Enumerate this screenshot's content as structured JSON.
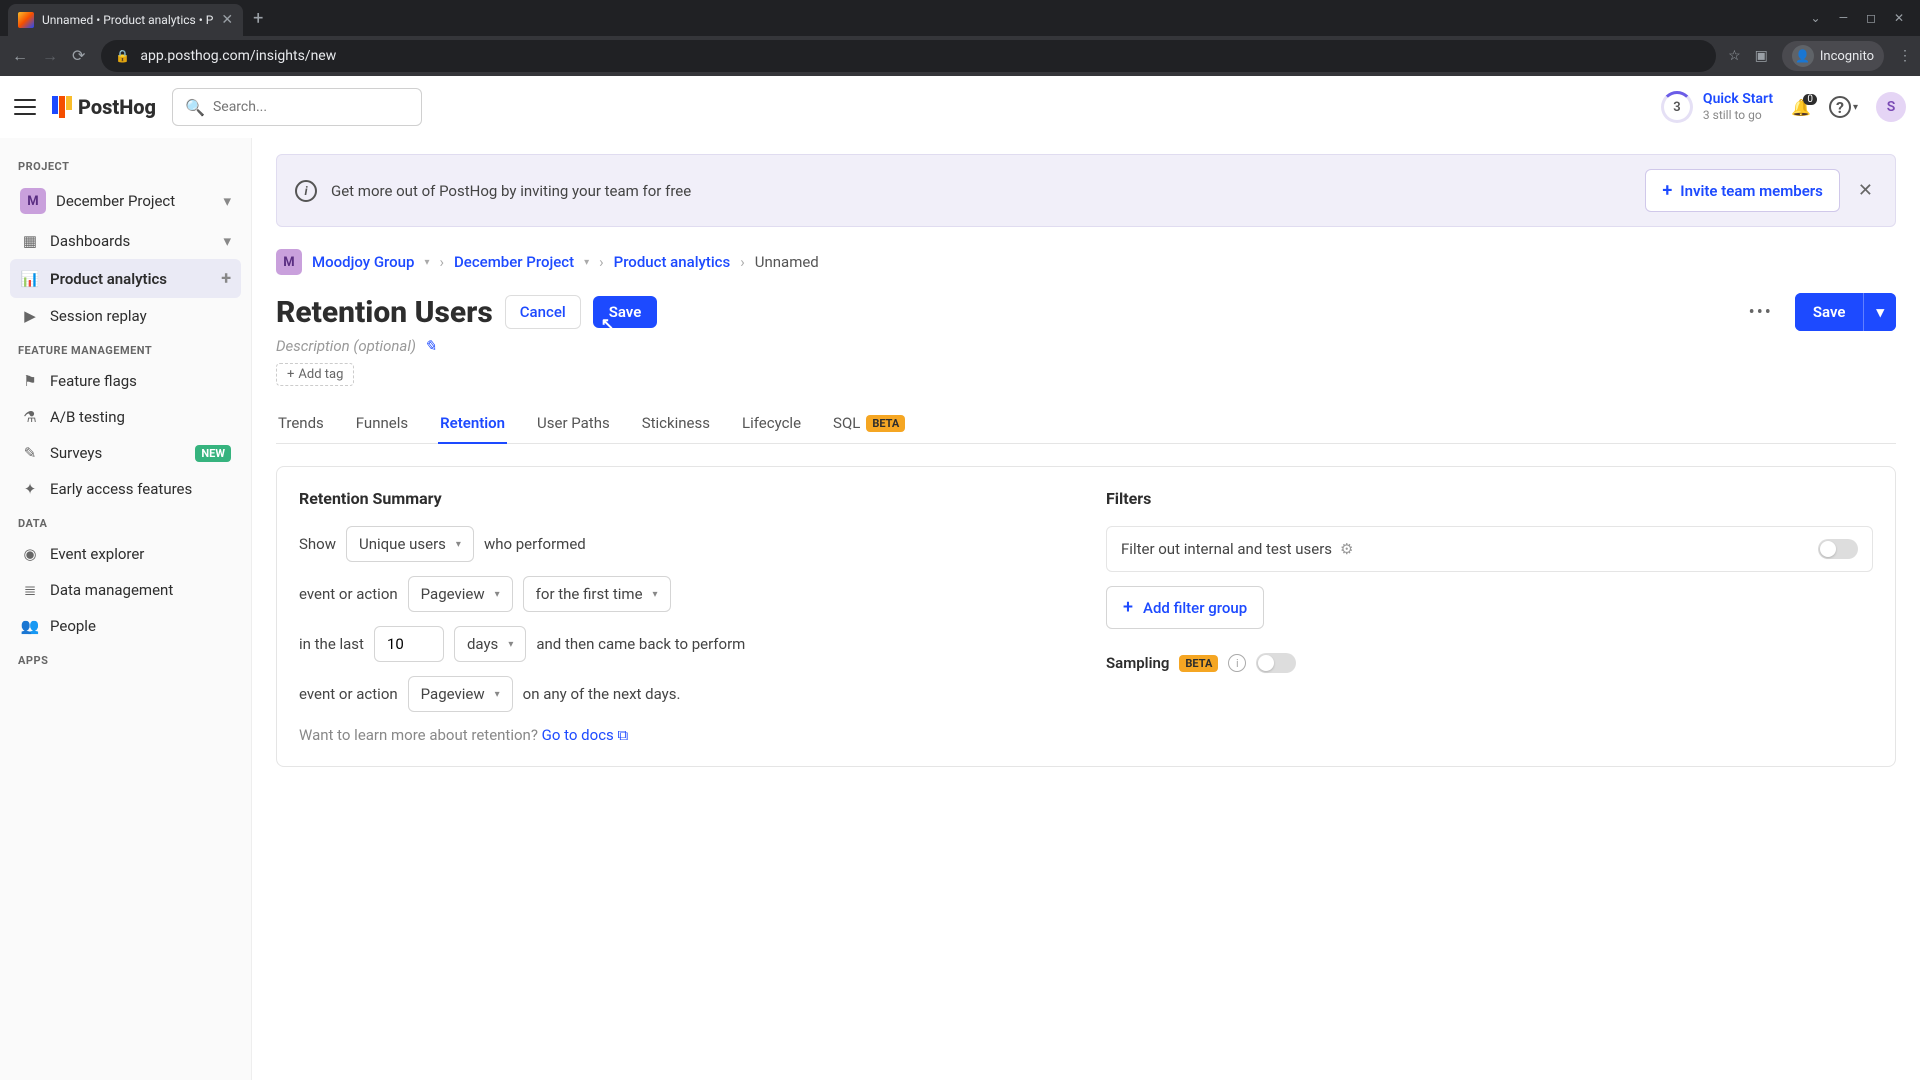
{
  "browser": {
    "tab_title": "Unnamed • Product analytics • P",
    "url": "app.posthog.com/insights/new",
    "incognito_label": "Incognito"
  },
  "topbar": {
    "logo_text": "PostHog",
    "search_placeholder": "Search...",
    "quickstart": {
      "count": "3",
      "title": "Quick Start",
      "subtitle": "3 still to go"
    },
    "notifications_badge": "0",
    "avatar_initial": "S"
  },
  "sidebar": {
    "sections": {
      "project": {
        "label": "PROJECT",
        "badge": "M",
        "name": "December Project"
      },
      "main": [
        {
          "icon": "▦",
          "label": "Dashboards",
          "trailing": "caret"
        },
        {
          "icon": "⫿",
          "label": "Product analytics",
          "trailing": "plus",
          "active": true
        },
        {
          "icon": "▶",
          "label": "Session replay"
        }
      ],
      "feature": {
        "label": "FEATURE MANAGEMENT",
        "items": [
          {
            "icon": "⚑",
            "label": "Feature flags"
          },
          {
            "icon": "⬓",
            "label": "A/B testing"
          },
          {
            "icon": "✎",
            "label": "Surveys",
            "badge": "NEW"
          },
          {
            "icon": "✦",
            "label": "Early access features"
          }
        ]
      },
      "data": {
        "label": "DATA",
        "items": [
          {
            "icon": "⟲",
            "label": "Event explorer"
          },
          {
            "icon": "≡",
            "label": "Data management"
          },
          {
            "icon": "👥",
            "label": "People"
          }
        ]
      },
      "apps": {
        "label": "APPS"
      }
    }
  },
  "banner": {
    "text": "Get more out of PostHog by inviting your team for free",
    "invite_label": "Invite team members"
  },
  "breadcrumbs": {
    "org_badge": "M",
    "org": "Moodjoy Group",
    "project": "December Project",
    "section": "Product analytics",
    "current": "Unnamed"
  },
  "title": {
    "text": "Retention Users",
    "cancel": "Cancel",
    "save_inline": "Save",
    "save_main": "Save",
    "description_placeholder": "Description (optional)",
    "add_tag": "Add tag"
  },
  "tabs": [
    "Trends",
    "Funnels",
    "Retention",
    "User Paths",
    "Stickiness",
    "Lifecycle"
  ],
  "tabs_sql": {
    "label": "SQL",
    "badge": "BETA"
  },
  "tabs_active": "Retention",
  "retention": {
    "heading": "Retention Summary",
    "show_label": "Show",
    "show_value": "Unique users",
    "who_performed": "who performed",
    "event_label1": "event or action",
    "event_value1": "Pageview",
    "first_time": "for the first time",
    "in_last": "in the last",
    "period_value": "10",
    "period_unit": "days",
    "came_back": "and then came back to perform",
    "event_label2": "event or action",
    "event_value2": "Pageview",
    "on_any": "on any of the next days.",
    "docs_prompt": "Want to learn more about retention?",
    "docs_link": "Go to docs"
  },
  "filters": {
    "heading": "Filters",
    "internal_label": "Filter out internal and test users",
    "add_group": "Add filter group",
    "sampling_label": "Sampling",
    "sampling_badge": "BETA"
  }
}
